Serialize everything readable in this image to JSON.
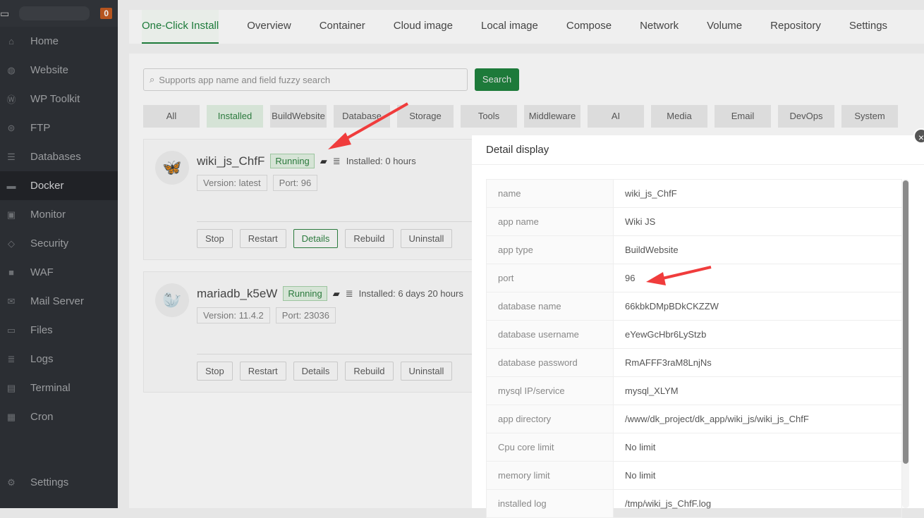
{
  "sidebar": {
    "badge": "0",
    "items": [
      {
        "label": "Home",
        "icon": "home-icon"
      },
      {
        "label": "Website",
        "icon": "globe-icon"
      },
      {
        "label": "WP Toolkit",
        "icon": "wordpress-icon"
      },
      {
        "label": "FTP",
        "icon": "ftp-icon"
      },
      {
        "label": "Databases",
        "icon": "database-icon"
      },
      {
        "label": "Docker",
        "icon": "docker-icon"
      },
      {
        "label": "Monitor",
        "icon": "monitor-icon"
      },
      {
        "label": "Security",
        "icon": "shield-icon"
      },
      {
        "label": "WAF",
        "icon": "waf-icon"
      },
      {
        "label": "Mail Server",
        "icon": "mail-icon"
      },
      {
        "label": "Files",
        "icon": "folder-icon"
      },
      {
        "label": "Logs",
        "icon": "logs-icon"
      },
      {
        "label": "Terminal",
        "icon": "terminal-icon"
      },
      {
        "label": "Cron",
        "icon": "calendar-icon"
      }
    ],
    "settings": "Settings"
  },
  "tabs": [
    "One-Click Install",
    "Overview",
    "Container",
    "Cloud image",
    "Local image",
    "Compose",
    "Network",
    "Volume",
    "Repository",
    "Settings"
  ],
  "search": {
    "placeholder": "Supports app name and field fuzzy search",
    "button": "Search"
  },
  "categories": [
    "All",
    "Installed",
    "BuildWebsite",
    "Database",
    "Storage",
    "Tools",
    "Middleware",
    "AI",
    "Media",
    "Email",
    "DevOps",
    "System"
  ],
  "apps": [
    {
      "name": "wiki_js_ChfF",
      "status": "Running",
      "installed": "Installed: 0 hours",
      "version": "Version: latest",
      "port": "Port: 96"
    },
    {
      "name": "mariadb_k5eW",
      "status": "Running",
      "installed": "Installed: 6 days 20 hours",
      "version": "Version: 11.4.2",
      "port": "Port: 23036"
    }
  ],
  "actions": [
    "Stop",
    "Restart",
    "Details",
    "Rebuild",
    "Uninstall"
  ],
  "modal": {
    "title": "Detail display",
    "rows": [
      {
        "k": "name",
        "v": "wiki_js_ChfF"
      },
      {
        "k": "app name",
        "v": "Wiki JS"
      },
      {
        "k": "app type",
        "v": "BuildWebsite"
      },
      {
        "k": "port",
        "v": "96"
      },
      {
        "k": "database name",
        "v": "66kbkDMpBDkCKZZW"
      },
      {
        "k": "database username",
        "v": "eYewGcHbr6LyStzb"
      },
      {
        "k": "database password",
        "v": "RmAFFF3raM8LnjNs"
      },
      {
        "k": "mysql IP/service",
        "v": "mysql_XLYM"
      },
      {
        "k": "app directory",
        "v": "/www/dk_project/dk_app/wiki_js/wiki_js_ChfF"
      },
      {
        "k": "Cpu core limit",
        "v": "No limit"
      },
      {
        "k": "memory limit",
        "v": "No limit"
      },
      {
        "k": "installed log",
        "v": "/tmp/wiki_js_ChfF.log"
      }
    ]
  }
}
